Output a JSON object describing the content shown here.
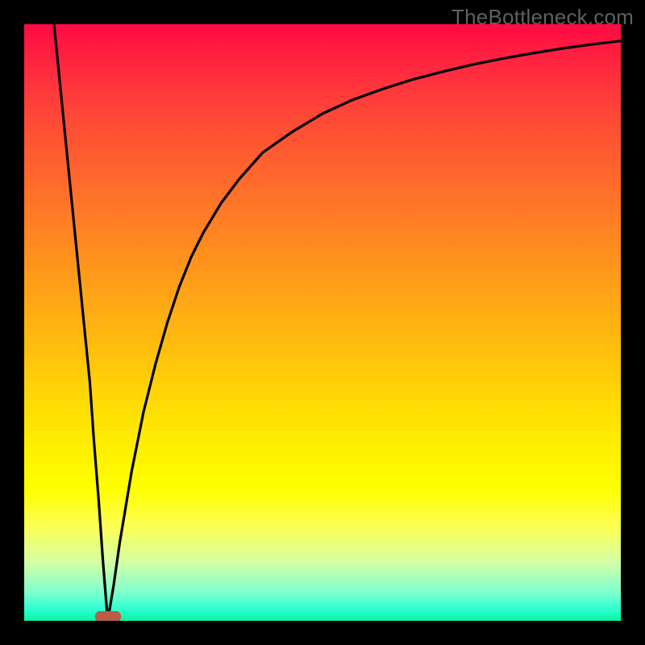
{
  "watermark": "TheBottleneck.com",
  "chart_data": {
    "type": "line",
    "title": "",
    "xlabel": "",
    "ylabel": "",
    "xlim": [
      0,
      100
    ],
    "ylim": [
      0,
      100
    ],
    "grid": false,
    "gradient_direction": "vertical",
    "series": [
      {
        "name": "curve",
        "x": [
          5,
          6,
          7,
          8,
          9,
          10,
          11,
          11.7,
          12.5,
          13.2,
          14,
          15,
          16,
          17,
          18,
          20,
          22,
          24,
          26,
          28,
          30,
          33,
          36,
          40,
          45,
          50,
          55,
          60,
          65,
          70,
          75,
          80,
          85,
          90,
          95,
          100
        ],
        "values": [
          100,
          90,
          80,
          70,
          60,
          50,
          40,
          30,
          20,
          10,
          0,
          6,
          13,
          19,
          25,
          35,
          43,
          50,
          56,
          61,
          65,
          70,
          74,
          78.5,
          82,
          85,
          87.3,
          89.1,
          90.7,
          92.0,
          93.2,
          94.2,
          95.1,
          95.9,
          96.6,
          97.2
        ]
      }
    ],
    "marker": {
      "x": 14,
      "y": 0,
      "color": "#bb5c49"
    },
    "background_gradient": [
      "#ff0a42",
      "#ffff00",
      "#0af59e"
    ]
  }
}
